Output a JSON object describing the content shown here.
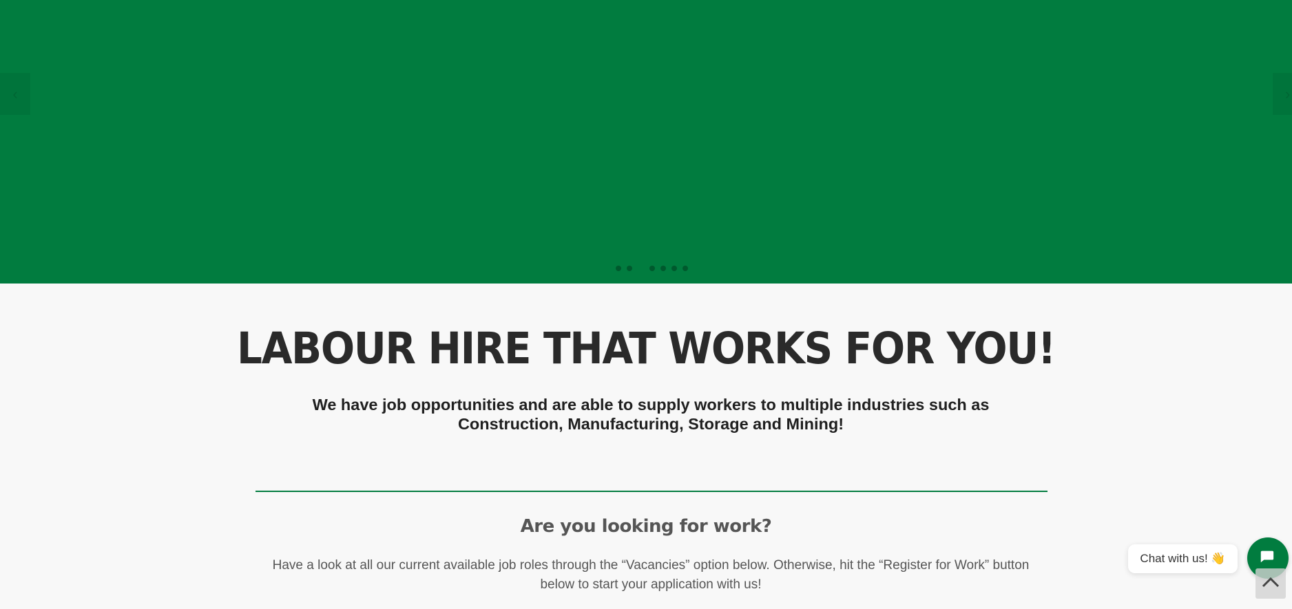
{
  "hero": {
    "bg_color": "#017c3f",
    "prev_arrow": "‹",
    "next_arrow": "›",
    "slide_count": 6
  },
  "main": {
    "heading": "LABOUR HIRE THAT WORKS FOR YOU!",
    "subheading": "We have job opportunities and are able to supply workers to multiple industries such as Construction, Manufacturing, Storage and Mining!",
    "section_title": "Are you looking for work?",
    "section_text": "Have a look at all our current available job roles through the “Vacancies” option below. Otherwise, hit the “Register for Work” button below to start your application with us!"
  },
  "chat": {
    "label": "Chat with us! 👋",
    "icon": "chat-icon"
  },
  "scroll_top": {
    "icon": "chevron-up-icon"
  }
}
